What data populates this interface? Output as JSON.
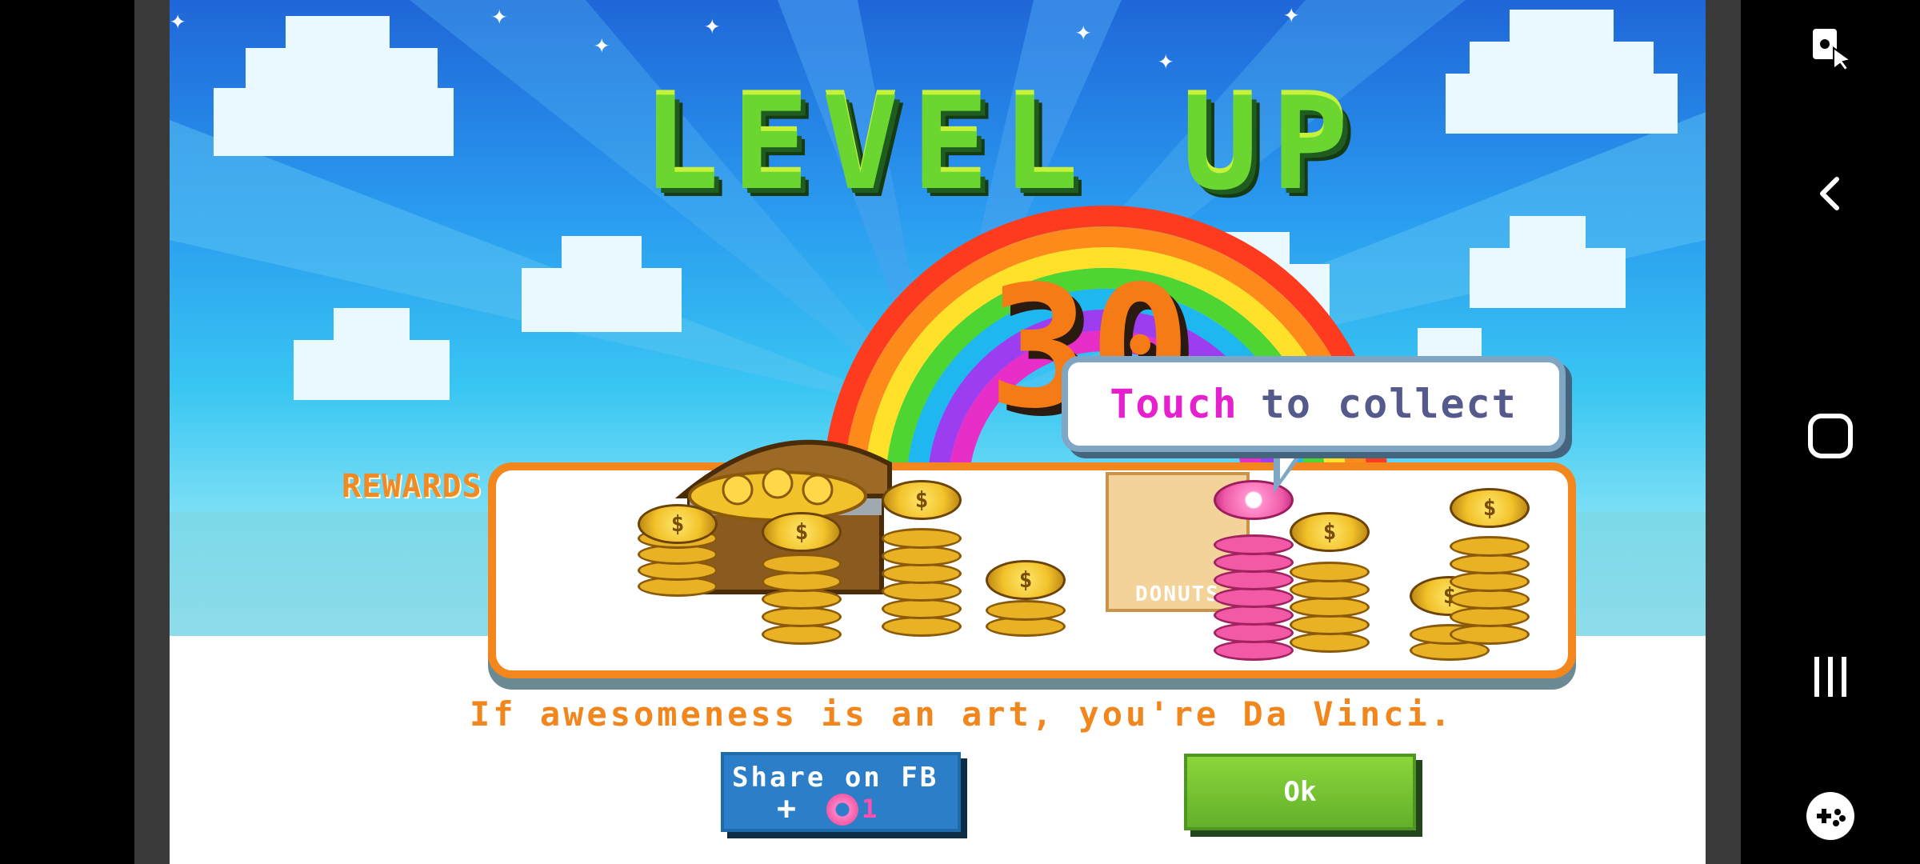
{
  "game": {
    "title": "LEVEL UP",
    "level": "30",
    "rewards_label": "REWARDS",
    "collect_prompt_highlight": "Touch",
    "collect_prompt_rest": "to collect",
    "donut_box_label": "DONUTS",
    "message": "If awesomeness is an art, you're Da Vinci.",
    "share_button_label": "Share on FB",
    "share_reward_amount": "1",
    "ok_button_label": "Ok"
  },
  "colors": {
    "title_green": "#6cd631",
    "level_orange": "#f57b16",
    "panel_border": "#f3861c",
    "collect_highlight": "#e61fcf",
    "share_blue": "#2b7ec7",
    "ok_green": "#7bc234"
  },
  "nav": {
    "icons": [
      "screen-lock-icon",
      "back-icon",
      "home-icon",
      "recents-icon",
      "game-tools-icon"
    ]
  }
}
